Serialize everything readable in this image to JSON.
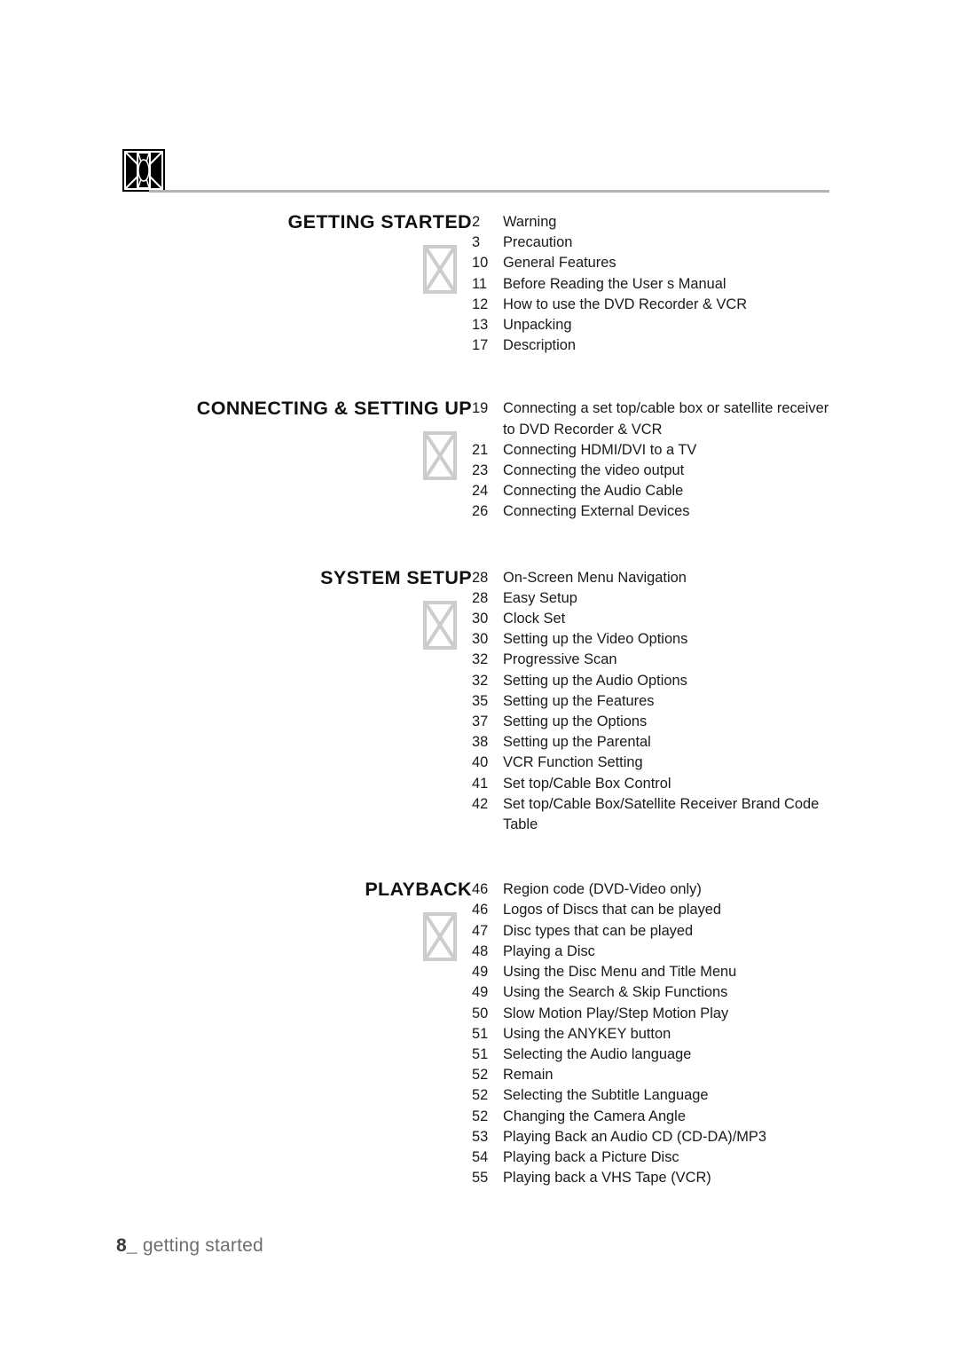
{
  "header": {
    "glyph_icon": "missing-glyph-box-icon",
    "rule": "horizontal-rule"
  },
  "footer": {
    "page_number": "8",
    "separator": "_",
    "label": "getting started"
  },
  "colors": {
    "text": "#1a1a1a",
    "heading": "#111111",
    "rule": "#b3b3b3",
    "placeholder": "#cccccc",
    "footer_label": "#6e6e6e",
    "footer_number": "#3a3a3a"
  },
  "toc": {
    "sections": [
      {
        "title": "GETTING STARTED",
        "thumb_icon": "image-placeholder-icon",
        "entries": [
          {
            "page": "2",
            "title": "Warning"
          },
          {
            "page": "3",
            "title": "Precaution"
          },
          {
            "page": "10",
            "title": "General Features"
          },
          {
            "page": "11",
            "title": "Before Reading the User s Manual"
          },
          {
            "page": "12",
            "title": "How to use the DVD Recorder & VCR"
          },
          {
            "page": "13",
            "title": "Unpacking"
          },
          {
            "page": "17",
            "title": "Description"
          }
        ]
      },
      {
        "title": "CONNECTING & SETTING UP",
        "thumb_icon": "image-placeholder-icon",
        "entries": [
          {
            "page": "19",
            "title": "Connecting a set top/cable box or satellite receiver to DVD Recorder & VCR"
          },
          {
            "page": "21",
            "title": "Connecting HDMI/DVI to a TV"
          },
          {
            "page": "23",
            "title": "Connecting the video output"
          },
          {
            "page": "24",
            "title": "Connecting the Audio Cable"
          },
          {
            "page": "26",
            "title": "Connecting External Devices"
          }
        ]
      },
      {
        "title": "SYSTEM SETUP",
        "thumb_icon": "image-placeholder-icon",
        "entries": [
          {
            "page": "28",
            "title": "On-Screen Menu Navigation"
          },
          {
            "page": "28",
            "title": "Easy Setup"
          },
          {
            "page": "30",
            "title": "Clock Set"
          },
          {
            "page": "30",
            "title": "Setting up the Video Options"
          },
          {
            "page": "32",
            "title": "Progressive Scan"
          },
          {
            "page": "32",
            "title": "Setting up the Audio Options"
          },
          {
            "page": "35",
            "title": "Setting up the Features"
          },
          {
            "page": "37",
            "title": "Setting up the Options"
          },
          {
            "page": "38",
            "title": "Setting up the Parental"
          },
          {
            "page": "40",
            "title": "VCR Function Setting"
          },
          {
            "page": "41",
            "title": "Set top/Cable Box Control"
          },
          {
            "page": "42",
            "title": "Set top/Cable Box/Satellite Receiver Brand Code Table"
          }
        ]
      },
      {
        "title": "PLAYBACK",
        "thumb_icon": "image-placeholder-icon",
        "entries": [
          {
            "page": "46",
            "title": "Region code (DVD-Video only)"
          },
          {
            "page": "46",
            "title": "Logos of Discs that can be played"
          },
          {
            "page": "47",
            "title": "Disc types that can be played"
          },
          {
            "page": "48",
            "title": "Playing a Disc"
          },
          {
            "page": "49",
            "title": "Using the Disc Menu and Title Menu"
          },
          {
            "page": "49",
            "title": "Using the Search & Skip Functions"
          },
          {
            "page": "50",
            "title": "Slow Motion Play/Step Motion Play"
          },
          {
            "page": "51",
            "title": "Using the ANYKEY button"
          },
          {
            "page": "51",
            "title": "Selecting the Audio language"
          },
          {
            "page": "52",
            "title": "Remain"
          },
          {
            "page": "52",
            "title": "Selecting the Subtitle Language"
          },
          {
            "page": "52",
            "title": "Changing the Camera Angle"
          },
          {
            "page": "53",
            "title": "Playing Back an Audio CD (CD-DA)/MP3"
          },
          {
            "page": "54",
            "title": "Playing back a Picture Disc"
          },
          {
            "page": "55",
            "title": "Playing back a VHS Tape (VCR)"
          }
        ]
      }
    ]
  }
}
